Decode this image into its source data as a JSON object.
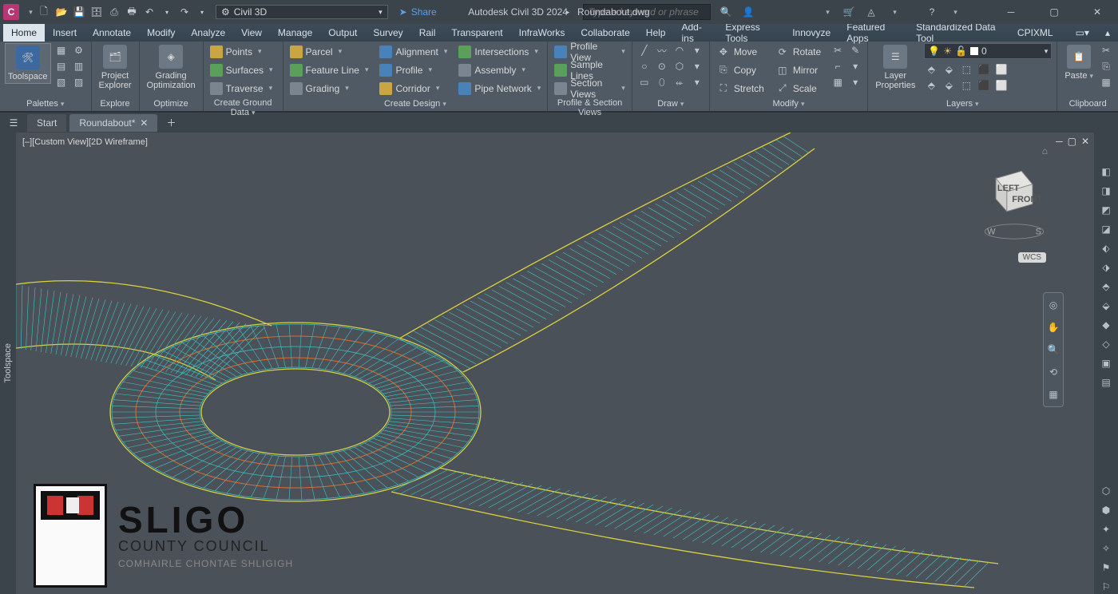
{
  "app": {
    "logo": "C",
    "workspace": "Civil 3D",
    "share": "Share",
    "name": "Autodesk Civil 3D 2024",
    "file": "Roundabout.dwg",
    "search_ph": "Type a keyword or phrase"
  },
  "menus": [
    "Home",
    "Insert",
    "Annotate",
    "Modify",
    "Analyze",
    "View",
    "Manage",
    "Output",
    "Survey",
    "Rail",
    "Transparent",
    "InfraWorks",
    "Collaborate",
    "Help",
    "Add-ins",
    "Express Tools",
    "Innovyze",
    "Featured Apps",
    "Standardized Data Tool",
    "CPIXML"
  ],
  "active_menu": "Home",
  "ribbon": {
    "toolspace": "Toolspace",
    "palettes": "Palettes",
    "explore": {
      "btn": "Project\nExplorer",
      "title": "Explore"
    },
    "optimize": {
      "btn": "Grading\nOptimization",
      "title": "Optimize"
    },
    "ground": {
      "title": "Create Ground Data",
      "items": [
        "Points",
        "Surfaces",
        "Traverse"
      ]
    },
    "design": {
      "title": "Create Design",
      "c1": [
        "Parcel",
        "Feature Line",
        "Grading"
      ],
      "c2": [
        "Alignment",
        "Profile",
        "Corridor"
      ],
      "c3": [
        "Intersections",
        "Assembly",
        "Pipe Network"
      ]
    },
    "profile": {
      "title": "Profile & Section Views",
      "items": [
        "Profile View",
        "Sample Lines",
        "Section Views"
      ]
    },
    "draw": {
      "title": "Draw"
    },
    "modify": {
      "title": "Modify",
      "items": [
        "Move",
        "Copy",
        "Stretch",
        "Rotate",
        "Mirror",
        "Scale"
      ]
    },
    "layers": {
      "title": "Layers",
      "btn": "Layer\nProperties",
      "current": "0"
    },
    "clipboard": {
      "title": "Clipboard",
      "btn": "Paste"
    }
  },
  "tabs": {
    "start": "Start",
    "doc": "Roundabout*"
  },
  "viewport": {
    "label": "[–][Custom View][2D Wireframe]",
    "wcs": "WCS",
    "cube_left": "LEFT",
    "cube_front": "FRONT"
  },
  "sidebar": "Toolspace",
  "watermark": {
    "l1": "SLIGO",
    "l2": "COUNTY COUNCIL",
    "l3": "COMHAIRLE CHONTAE SHLIGIGH"
  }
}
